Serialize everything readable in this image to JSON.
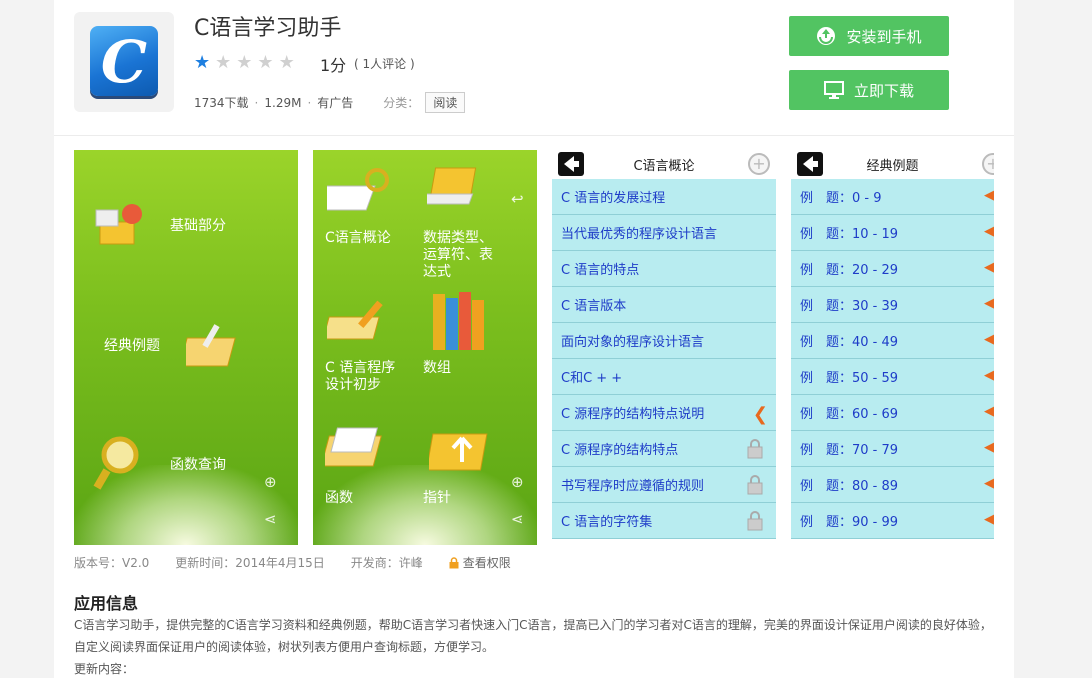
{
  "app": {
    "title": "C语言学习助手",
    "icon_letter": "C",
    "rating_stars": 1,
    "rating_max": 5,
    "score": "1分",
    "reviews": "( 1人评论 )",
    "downloads": "1734下载",
    "size": "1.29M",
    "ads": "有广告",
    "category_label": "分类：",
    "category": "阅读",
    "dot": "·"
  },
  "buttons": {
    "install": "安装到手机",
    "download": "立即下载"
  },
  "shot1": {
    "items": [
      "基础部分",
      "经典例题",
      "函数查询"
    ]
  },
  "shot2": {
    "items": [
      "C语言概论",
      "数据类型、\n运算符、表\n达式",
      "C 语言程序\n设计初步",
      "数组",
      "函数",
      "指针"
    ]
  },
  "shot3": {
    "title": "C语言概论",
    "rows": [
      "C 语言的发展过程",
      "当代最优秀的程序设计语言",
      "C 语言的特点",
      "C 语言版本",
      "面向对象的程序设计语言",
      "C和C + +",
      "C 源程序的结构特点说明",
      "C 源程序的结构特点",
      "书写程序时应遵循的规则",
      "C 语言的字符集"
    ]
  },
  "shot4": {
    "title": "经典例题",
    "rows": [
      "例　题：0 - 9",
      "例　题：10 - 19",
      "例　题：20 - 29",
      "例　题：30 - 39",
      "例　题：40 - 49",
      "例　题：50 - 59",
      "例　题：60 - 69",
      "例　题：70 - 79",
      "例　题：80 - 89",
      "例　题：90 - 99"
    ]
  },
  "info": {
    "version": "版本号：V2.0",
    "updated": "更新时间：2014年4月15日",
    "developer": "开发商：许峰",
    "permissions": "查看权限"
  },
  "section": {
    "title": "应用信息",
    "description": "C语言学习助手，提供完整的C语言学习资料和经典例题，帮助C语言学习者快速入门C语言，提高已入门的学习者对C语言的理解，完美的界面设计保证用户阅读的良好体验，自定义阅读界面保证用户的阅读体验，树状列表方便用户查询标题，方便学习。",
    "update_label": "更新内容："
  },
  "colors": {
    "accent_green": "#52c462",
    "star_blue": "#1e7fe0",
    "list_bg": "#b8ecf0",
    "list_text": "#1e3cc8"
  }
}
